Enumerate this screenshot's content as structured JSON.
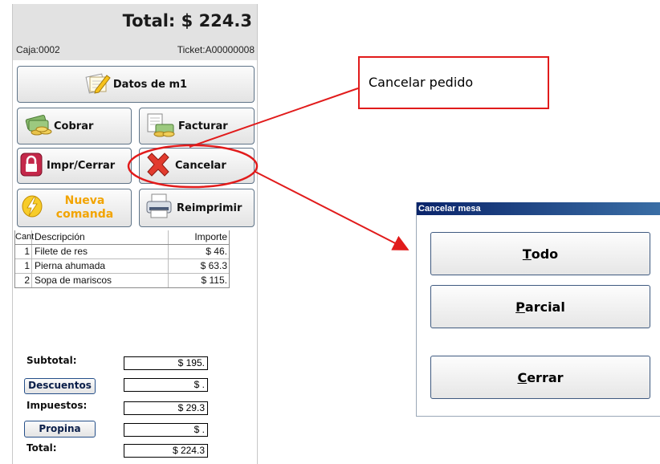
{
  "pos": {
    "total_header": "Total: $ 224.3",
    "caja": "Caja:0002",
    "ticket": "Ticket:A00000008",
    "buttons": {
      "datos": "Datos de m1",
      "cobrar": "Cobrar",
      "facturar": "Facturar",
      "impr_cerrar": "Impr/Cerrar",
      "cancelar": "Cancelar",
      "nueva_line1": "Nueva",
      "nueva_line2": "comanda",
      "reimprimir": "Reimprimir"
    },
    "table": {
      "headers": {
        "cant": "Cant",
        "desc": "Descripción",
        "importe": "Importe"
      },
      "rows": [
        {
          "cant": "1",
          "desc": "Filete de res",
          "importe": "$ 46."
        },
        {
          "cant": "1",
          "desc": "Pierna ahumada",
          "importe": "$ 63.3"
        },
        {
          "cant": "2",
          "desc": "Sopa de mariscos",
          "importe": "$ 115."
        }
      ]
    },
    "totals": {
      "subtotal_label": "Subtotal:",
      "subtotal_value": "$ 195.",
      "descuentos_button": "Descuentos",
      "descuentos_value": "$ .",
      "impuestos_label": "Impuestos:",
      "impuestos_value": "$ 29.3",
      "propina_button": "Propina",
      "propina_value": "$ .",
      "total_label": "Total:",
      "total_value": "$ 224.3"
    }
  },
  "callout": {
    "text": "Cancelar pedido"
  },
  "dialog": {
    "title": "Cancelar mesa",
    "todo": {
      "mnemonic": "T",
      "rest": "odo"
    },
    "parcial": {
      "mnemonic": "P",
      "rest": "arcial"
    },
    "cerrar": {
      "mnemonic": "C",
      "rest": "errar"
    }
  },
  "colors": {
    "annotation": "#e11b1b",
    "nueva_text": "#f2a400",
    "title_bar": "#0a246a"
  },
  "icons": [
    "document-pencil-icon",
    "money-coins-icon",
    "invoice-coins-icon",
    "lock-icon",
    "red-x-icon",
    "lightning-icon",
    "printer-icon"
  ]
}
